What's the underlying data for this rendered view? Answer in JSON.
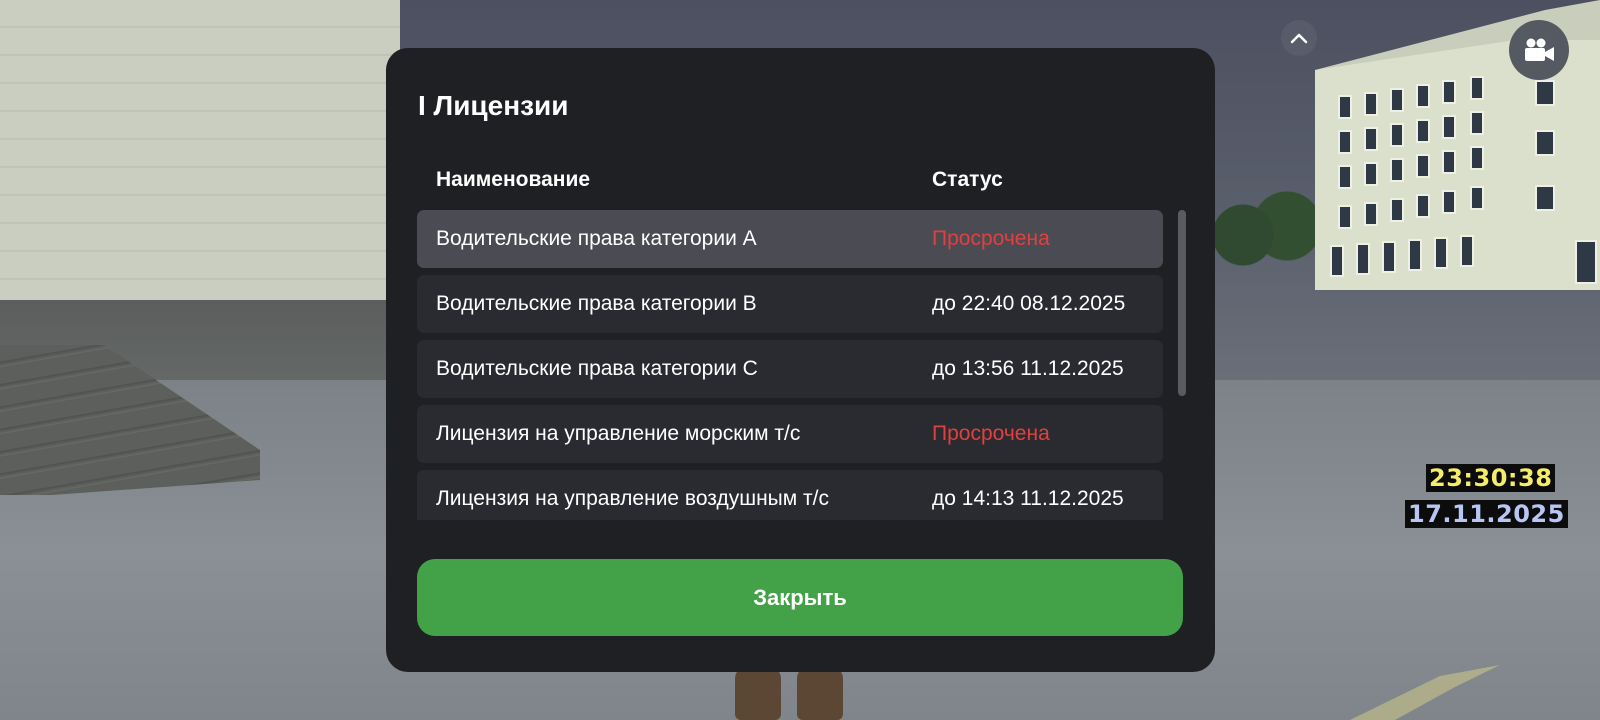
{
  "hud": {
    "time": "23:30:38",
    "date": "17.11.2025"
  },
  "modal": {
    "title": "I Лицензии",
    "columns": {
      "name": "Наименование",
      "status": "Статус"
    },
    "rows": [
      {
        "name": "Водительские права категории A",
        "status": "Просрочена",
        "expired": true,
        "selected": true
      },
      {
        "name": "Водительские права категории B",
        "status": "до 22:40 08.12.2025",
        "expired": false,
        "selected": false
      },
      {
        "name": "Водительские права категории C",
        "status": "до 13:56 11.12.2025",
        "expired": false,
        "selected": false
      },
      {
        "name": "Лицензия на управление морским т/с",
        "status": "Просрочена",
        "expired": true,
        "selected": false
      },
      {
        "name": "Лицензия на управление воздушным т/с",
        "status": "до 14:13 11.12.2025",
        "expired": false,
        "selected": false
      }
    ],
    "close_label": "Закрыть"
  },
  "icons": {
    "chevron": "chevron-up-icon",
    "camera": "video-camera-icon"
  },
  "colors": {
    "modal_bg": "#1f2024",
    "row_bg": "#2a2b30",
    "row_selected_bg": "#4b4c53",
    "expired": "#e0403f",
    "close_button": "#43a247",
    "clock_time": "#f5ec6a",
    "clock_date": "#b8c6f4"
  }
}
